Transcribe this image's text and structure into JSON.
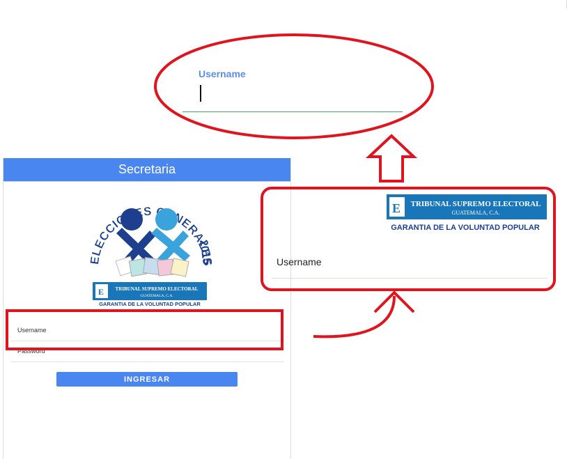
{
  "zoom_top": {
    "label": "Username"
  },
  "app": {
    "title": "Secretaria",
    "logo": {
      "arc_text": "ELECCIONES GENERALES",
      "year": "2015",
      "tse_name": "TRIBUNAL SUPREMO ELECTORAL",
      "tse_country": "GUATEMALA, C.A.",
      "tse_slogan": "GARANTIA DE LA VOLUNTAD POPULAR"
    },
    "fields": {
      "username_label": "Username",
      "password_label": "Password"
    },
    "submit_label": "INGRESAR"
  },
  "zoom_right": {
    "tse_name": "TRIBUNAL SUPREMO ELECTORAL",
    "tse_country": "GUATEMALA, C.A.",
    "tse_slogan": "GARANTIA DE LA VOLUNTAD POPULAR",
    "field_label": "Username"
  },
  "colors": {
    "header_blue": "#4a86f0",
    "annotation_red": "#e0141e",
    "focus_green": "#35b45e",
    "focus_label_blue": "#5c8ee8",
    "tse_blue": "#1976b8"
  }
}
